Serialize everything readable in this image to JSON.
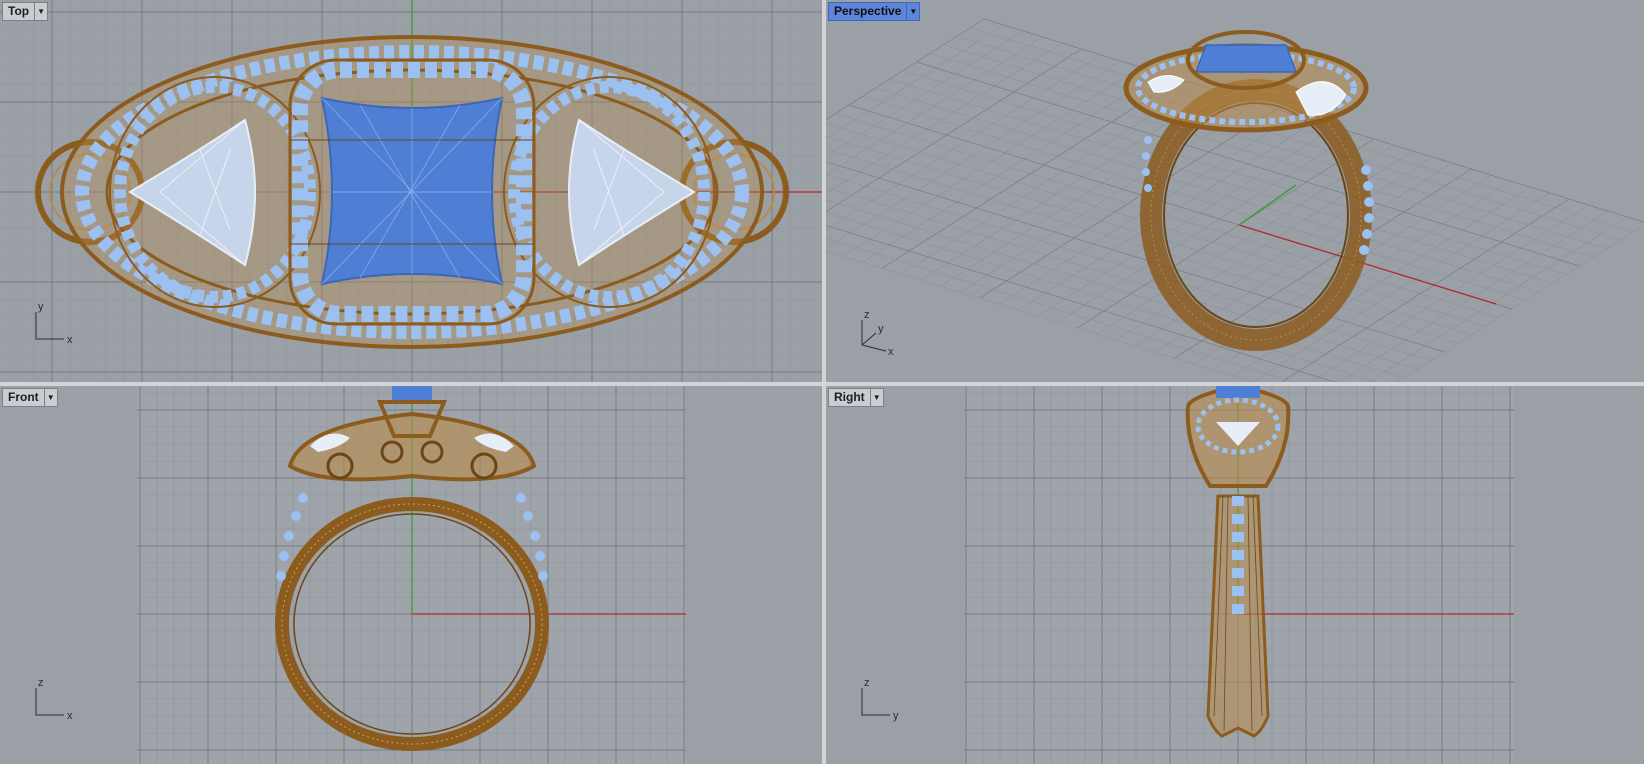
{
  "viewports": {
    "top": {
      "label": "Top",
      "active": false,
      "axes": [
        "y",
        "x"
      ]
    },
    "perspective": {
      "label": "Perspective",
      "active": true,
      "axes": [
        "z",
        "y",
        "x"
      ]
    },
    "front": {
      "label": "Front",
      "active": false,
      "axes": [
        "z",
        "x"
      ]
    },
    "right": {
      "label": "Right",
      "active": false,
      "axes": [
        "z",
        "y"
      ]
    }
  },
  "icons": {
    "viewport_menu": "dropdown-arrow-icon"
  },
  "colors": {
    "viewport_bg": "#9aa0a6",
    "grid_minor": "#8d939a",
    "grid_major": "#767c83",
    "x_axis": "#b02a2a",
    "y_axis": "#2aa02a",
    "metal": "#8c5c1e",
    "metal_light": "#b98a48",
    "gem_blue": "#4f7fd4",
    "gem_light": "#9cc0f0",
    "gem_white": "#e8eef7",
    "active_label": "#5d86d9"
  }
}
